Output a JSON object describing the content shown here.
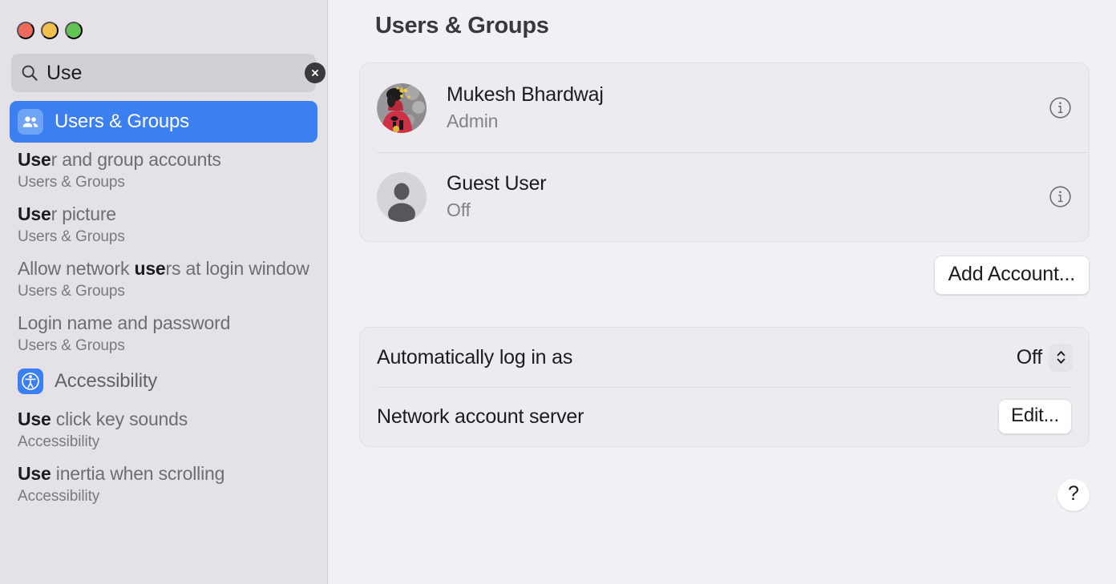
{
  "window": {
    "traffic_lights": [
      {
        "name": "close",
        "color": "#ec6a5e"
      },
      {
        "name": "minimize",
        "color": "#f0bf4c"
      },
      {
        "name": "maximize",
        "color": "#61c454"
      }
    ]
  },
  "search": {
    "value": "Use",
    "placeholder": "Search",
    "icon": "search-icon",
    "clear_icon": "close-circle-icon"
  },
  "sidebar": {
    "selected_result": {
      "title": "Users & Groups",
      "match": "Use",
      "rest": "rs & Groups",
      "icon": "users-group-icon",
      "icon_color": "#6fa3f5",
      "highlight_color": "#3b7ff0"
    },
    "hits": [
      {
        "match": "Use",
        "rest": "r and group accounts",
        "subtitle": "Users & Groups"
      },
      {
        "match": "Use",
        "rest": "r picture",
        "subtitle": "Users & Groups"
      },
      {
        "prefix": "Allow network ",
        "match": "use",
        "rest": "rs at login window",
        "subtitle": "Users & Groups"
      },
      {
        "match": "",
        "rest": "Login name and password",
        "subtitle": "Users & Groups"
      }
    ],
    "section": {
      "title": "Accessibility",
      "icon": "accessibility-icon",
      "icon_color": "#3b7ff0",
      "hits": [
        {
          "match": "Use",
          "rest": " click key sounds",
          "subtitle": "Accessibility"
        },
        {
          "match": "Use",
          "rest": " inertia when scrolling",
          "subtitle": "Accessibility"
        }
      ]
    }
  },
  "main": {
    "title": "Users & Groups",
    "accounts": [
      {
        "name": "Mukesh Bhardwaj",
        "role": "Admin",
        "avatar": "photo-avatar",
        "info_icon": "info-circle-icon"
      },
      {
        "name": "Guest User",
        "role": "Off",
        "avatar": "person-placeholder-avatar",
        "info_icon": "info-circle-icon"
      }
    ],
    "add_account_label": "Add Account...",
    "settings": [
      {
        "label": "Automatically log in as",
        "value": "Off",
        "control": "popup-stepper"
      },
      {
        "label": "Network account server",
        "button_label": "Edit...",
        "control": "button"
      }
    ],
    "help_label": "?"
  }
}
